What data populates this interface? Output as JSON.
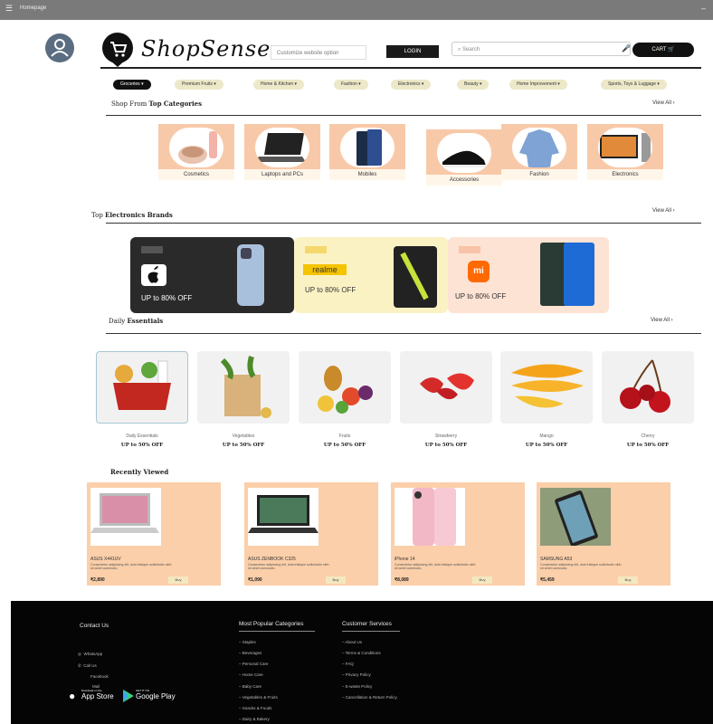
{
  "window": {
    "title": "Homepage",
    "menu_glyph": "☰",
    "close_glyph": "–"
  },
  "header": {
    "brand": "ShopSense",
    "location_placeholder": "Customize website option",
    "login_label": "LOGIN",
    "search_placeholder": "Search",
    "cart_label": "CART",
    "icons": {
      "avatar": "user-icon",
      "logo": "shopping-cart-icon",
      "mic": "mic-icon",
      "cart": "cart-icon",
      "search": "search-icon"
    }
  },
  "nav": [
    {
      "label": "Groceries",
      "active": true
    },
    {
      "label": "Premium Fruits",
      "active": false
    },
    {
      "label": "Home & Kitchen",
      "active": false
    },
    {
      "label": "Fashion",
      "active": false
    },
    {
      "label": "Electronics",
      "active": false
    },
    {
      "label": "Beauty",
      "active": false
    },
    {
      "label": "Home Improvement",
      "active": false
    },
    {
      "label": "Sports, Toys & Luggage",
      "active": false
    }
  ],
  "top_categories": {
    "title_prefix": "Shop From ",
    "title_bold": "Top Categories",
    "view_all": "View All",
    "items": [
      "Cosmetics",
      "Laptops and PCs",
      "Mobiles",
      "Accessories",
      "Fashion",
      "Electronics"
    ]
  },
  "electronics_brands": {
    "title_prefix": "Top ",
    "title_bold": "Electronics Brands",
    "view_all": "View All",
    "cards": [
      {
        "tag": "",
        "logo": "apple-logo",
        "offer": "UP to 80% OFF"
      },
      {
        "tag": "",
        "logo": "realme",
        "offer": "UP to 80% OFF"
      },
      {
        "tag": "",
        "logo": "mi",
        "offer": "UP to 80% OFF"
      }
    ]
  },
  "daily_essentials": {
    "title_prefix": "Daily ",
    "title_bold": "Essentials",
    "view_all": "View All",
    "items": [
      {
        "name": "Daily Essentials",
        "offer": "UP to 50% OFF"
      },
      {
        "name": "Vegetables",
        "offer": "UP to 50% OFF"
      },
      {
        "name": "Fruits",
        "offer": "UP to 50% OFF"
      },
      {
        "name": "Strawberry",
        "offer": "UP to 50% OFF"
      },
      {
        "name": "Mango",
        "offer": "UP to 50% OFF"
      },
      {
        "name": "Cherry",
        "offer": "UP to 50% OFF"
      }
    ]
  },
  "recently_viewed": {
    "title": "Recently Viewed",
    "items": [
      {
        "name": "ASUS X441UV",
        "desc": "Consectetur adipiscing elit, duis tristique sollicitudin nibh sit amet commodo.",
        "price": "₹2,890",
        "button": "Buy"
      },
      {
        "name": "ASUS ZENBOOK C325",
        "desc": "Consectetur adipiscing elit, duis tristique sollicitudin nibh sit amet commodo.",
        "price": "₹1,090",
        "button": "Buy"
      },
      {
        "name": "iPhone 14",
        "desc": "Consectetur adipiscing elit, duis tristique sollicitudin nibh sit amet commodo.",
        "price": "₹8,089",
        "button": "Buy"
      },
      {
        "name": "SAMSUNG A53",
        "desc": "Consectetur adipiscing elit, duis tristique sollicitudin nibh sit amet commodo.",
        "price": "₹5,459",
        "button": "Buy"
      }
    ]
  },
  "footer": {
    "contact_title": "Contact Us",
    "contact_items": [
      "WhatsApp",
      "Call Us",
      "Facebook",
      "Mail"
    ],
    "app_store": "App Store",
    "app_store_small": "Download on the",
    "google_play": "Google Play",
    "google_play_small": "GET IT ON",
    "popular_title": "Most Popular Categories",
    "popular_items": [
      "Staples",
      "Beverages",
      "Personal Care",
      "Home Care",
      "Baby Care",
      "Vegetables & Fruits",
      "Snacks & Foods",
      "Dairy & Bakery"
    ],
    "services_title": "Customer Services",
    "services_items": [
      "About Us",
      "Terms & Conditions",
      "FAQ",
      "Privacy Policy",
      "E-waste Policy",
      "Cancellation & Return Policy"
    ]
  }
}
